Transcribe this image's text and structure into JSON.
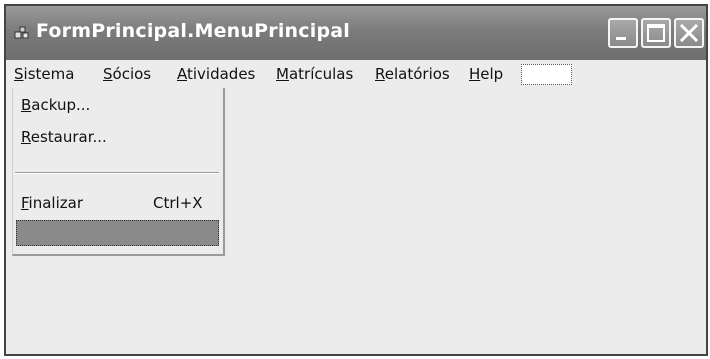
{
  "window": {
    "title": "FormPrincipal.MenuPrincipal",
    "icon": "form-app-icon",
    "controls": [
      "minimize-icon",
      "maximize-icon",
      "close-icon"
    ]
  },
  "menubar": {
    "items": [
      {
        "hotkey": "S",
        "rest": "istema"
      },
      {
        "hotkey": "S",
        "rest": "ócios"
      },
      {
        "hotkey": "A",
        "rest": "tividades"
      },
      {
        "hotkey": "M",
        "rest": "atrículas"
      },
      {
        "hotkey": "R",
        "rest": "elatórios"
      },
      {
        "hotkey": "H",
        "rest": "elp"
      }
    ]
  },
  "dropdown": {
    "items": [
      {
        "hotkey": "B",
        "rest": "ackup..."
      },
      {
        "hotkey": "R",
        "rest": "estaurar..."
      },
      {
        "hotkey": "F",
        "rest": "inalizar",
        "shortcut": "Ctrl+X"
      }
    ]
  },
  "colors": {
    "titlebar": "#7c7c7c",
    "window_bg": "#ececec",
    "highlight": "#8a8a8a"
  }
}
